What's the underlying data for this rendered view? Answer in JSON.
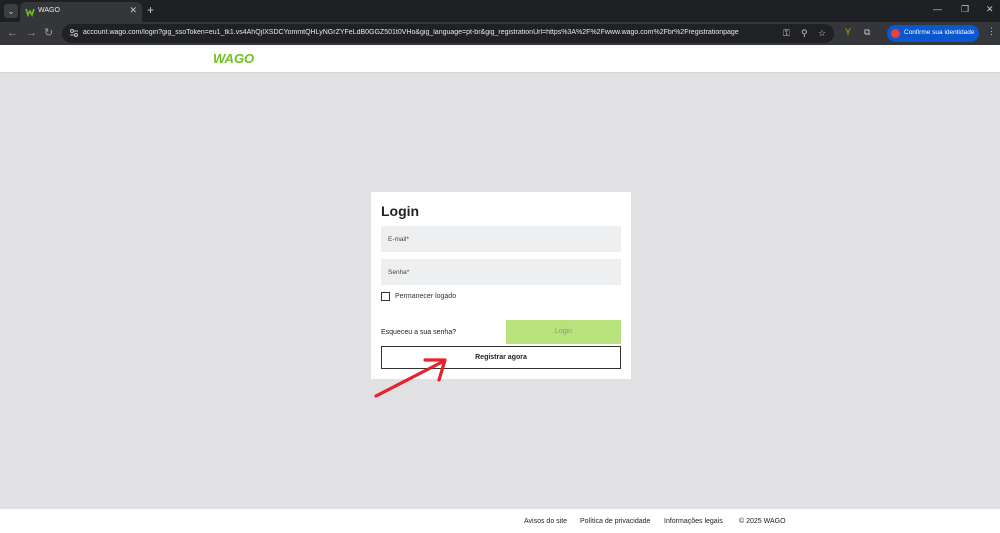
{
  "browser": {
    "tab_title": "WAGO",
    "url": "account.wago.com/login?gig_ssoToken=eu1_tk1.vs4AhQjIXSDCYommtQHLyNGrZYFeLdB0GGZ501t0VHo&gig_language=pt-br&gig_registrationUrl=https%3A%2F%2Fwww.wago.com%2Fbr%2Fregistrationpage",
    "identity_label": "Confirme sua identidade",
    "accent_color": "#0b57d0"
  },
  "header": {
    "logo_text": "WAGO",
    "brand_color": "#6ec01e"
  },
  "login": {
    "title": "Login",
    "email_placeholder": "E-mail*",
    "password_placeholder": "Senha*",
    "remember_label": "Permanecer logado",
    "forgot_label": "Esqueceu a sua senha?",
    "login_button": "Login",
    "register_button": "Registrar agora"
  },
  "footer": {
    "links": [
      "Avisos do site",
      "Política de privacidade",
      "Informações legais"
    ],
    "copyright": "© 2025 WAGO"
  }
}
